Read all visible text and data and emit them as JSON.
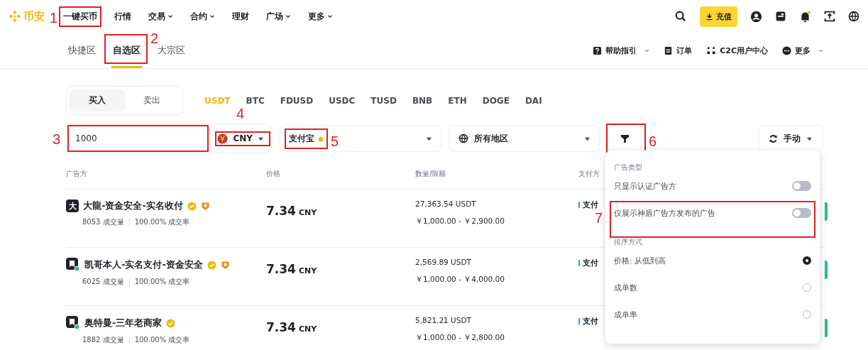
{
  "nav": {
    "logo": "币安",
    "items": [
      {
        "label": "一键买币",
        "dropdown": false,
        "annotation": "1"
      },
      {
        "label": "行情",
        "dropdown": false
      },
      {
        "label": "交易",
        "dropdown": true
      },
      {
        "label": "合约",
        "dropdown": true
      },
      {
        "label": "理财",
        "dropdown": false
      },
      {
        "label": "广场",
        "dropdown": true
      },
      {
        "label": "更多",
        "dropdown": true
      }
    ],
    "deposit_button": "充值"
  },
  "subnav": {
    "tabs": [
      {
        "label": "快捷区",
        "selected": false
      },
      {
        "label": "自选区",
        "selected": true,
        "annotation": "2"
      },
      {
        "label": "大宗区",
        "selected": false
      }
    ],
    "links": [
      {
        "label": "帮助指引",
        "dropdown": true
      },
      {
        "label": "订单",
        "dropdown": false
      },
      {
        "label": "C2C用户中心",
        "dropdown": false
      },
      {
        "label": "更多",
        "dropdown": true
      }
    ]
  },
  "trade_toggle": [
    {
      "label": "买入",
      "selected": true
    },
    {
      "label": "卖出",
      "selected": false
    }
  ],
  "assets": [
    {
      "label": "USDT",
      "selected": true
    },
    {
      "label": "BTC",
      "selected": false
    },
    {
      "label": "FDUSD",
      "selected": false
    },
    {
      "label": "USDC",
      "selected": false
    },
    {
      "label": "TUSD",
      "selected": false
    },
    {
      "label": "BNB",
      "selected": false
    },
    {
      "label": "ETH",
      "selected": false
    },
    {
      "label": "DOGE",
      "selected": false
    },
    {
      "label": "DAI",
      "selected": false
    }
  ],
  "filters": {
    "amount": {
      "value": "1000",
      "annotation": "3"
    },
    "currency": {
      "value": "CNY",
      "annotation": "4"
    },
    "payment": {
      "value": "支付宝",
      "annotation": "5"
    },
    "region": {
      "value": "所有地区"
    },
    "filter_button": {
      "annotation": "6"
    },
    "refresh": {
      "value": "手动"
    }
  },
  "table": {
    "columns": [
      "广告方",
      "价格",
      "数量/限额",
      "支付方"
    ],
    "rows": [
      {
        "avatar": "大",
        "online": false,
        "name": "大龍-资金安全-实名收付",
        "verified": true,
        "shield": true,
        "orders": "8053 成交量",
        "completion": "100.00% 成交率",
        "price": "7.34",
        "currency": "CNY",
        "quantity": "27,363.54 USDT",
        "limit": "￥1,000.00 - ￥2,900.00",
        "payment": "支付"
      },
      {
        "online": true,
        "name": "凯哥本人-实名支付-资金安全",
        "verified": true,
        "shield": true,
        "orders": "6025 成交量",
        "completion": "100.00% 成交率",
        "price": "7.34",
        "currency": "CNY",
        "quantity": "2,569.89 USDT",
        "limit": "￥1,000.00 - ￥4,000.00",
        "payment": "支付"
      },
      {
        "online": true,
        "name": "奥特曼-三年老商家",
        "verified": true,
        "shield": false,
        "orders": "1882 成交量",
        "completion": "100.00% 成交率",
        "price": "7.34",
        "currency": "CNY",
        "quantity": "5,821.21 USDT",
        "limit": "￥1,000.00 - ￥2,800.00",
        "payment": "支付"
      }
    ]
  },
  "filter_menu": {
    "sections": [
      {
        "title": "广告类型",
        "items": [
          {
            "kind": "toggle",
            "label": "只显示认证广告方",
            "on": false
          },
          {
            "kind": "toggle",
            "label": "仅展示神盾广告方发布的广告",
            "on": false,
            "annotation": "7"
          }
        ]
      },
      {
        "title": "排序方式",
        "items": [
          {
            "kind": "radio",
            "label": "价格: 从低到高",
            "selected": true
          },
          {
            "kind": "radio",
            "label": "成单数",
            "selected": false
          },
          {
            "kind": "radio",
            "label": "成单率",
            "selected": false
          }
        ]
      }
    ]
  }
}
